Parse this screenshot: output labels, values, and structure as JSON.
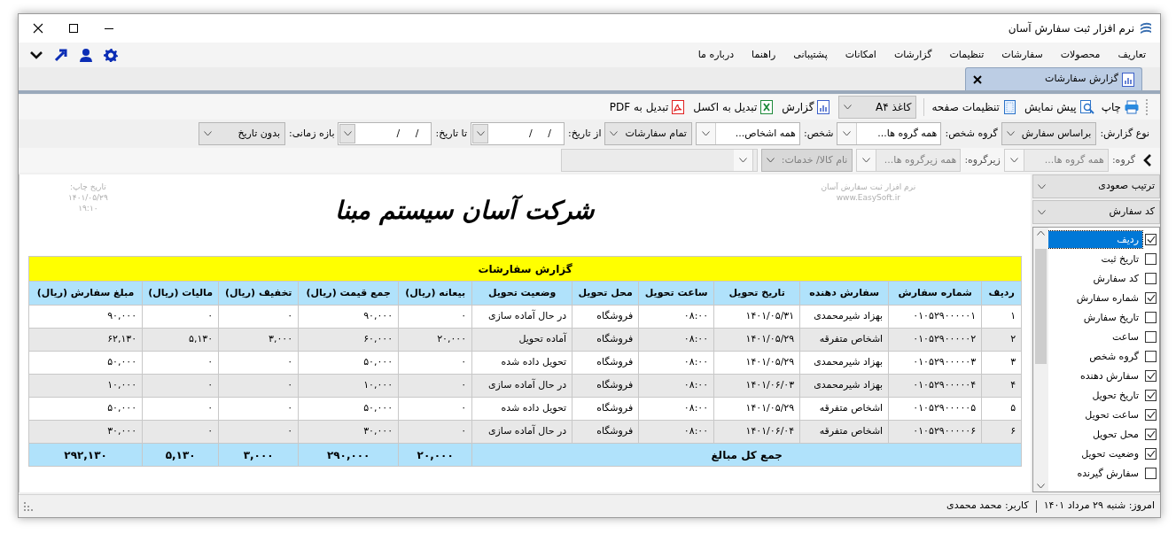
{
  "window": {
    "title": "نرم افزار ثبت سفارش آسان"
  },
  "menu": {
    "items": [
      "تعاریف",
      "محصولات",
      "سفارشات",
      "تنظیمات",
      "گزارشات",
      "امکانات",
      "پشتیبانی",
      "راهنما",
      "درباره ما"
    ]
  },
  "tabs": [
    {
      "label": "گزارش سفارشات",
      "selected": true
    }
  ],
  "toolbar": [
    {
      "kind": "print",
      "label": "چاپ"
    },
    {
      "kind": "preview",
      "label": "پیش نمایش"
    },
    {
      "kind": "page-setup",
      "label": "تنظیمات صفحه"
    },
    {
      "kind": "dropdown",
      "label": "کاغذ A۴"
    },
    {
      "kind": "report",
      "label": "گزارش"
    },
    {
      "kind": "excel",
      "label": "تبدیل به اکسل"
    },
    {
      "kind": "pdf",
      "label": "تبدیل به PDF"
    }
  ],
  "filters": [
    {
      "kind": "select",
      "label": "نوع گزارش:",
      "value": "براساس سفارش"
    },
    {
      "kind": "entry",
      "label": "گروه شخص:",
      "value": "همه گروه ها..."
    },
    {
      "kind": "entry",
      "label": "شخص:",
      "value": "همه اشخاص..."
    },
    {
      "kind": "select",
      "value": "تمام سفارشات"
    },
    {
      "kind": "date",
      "label": "از تاریخ:",
      "value": "/     /"
    },
    {
      "kind": "date",
      "label": "تا تاریخ:",
      "value": "/     /"
    },
    {
      "kind": "select",
      "label": "بازه زمانی:",
      "value": "بدون تاریخ"
    }
  ],
  "filters_2": [
    {
      "kind": "entry",
      "label": "گروه:",
      "value": "همه گروه ها...",
      "disabled": true
    },
    {
      "kind": "entry",
      "label": "زیرگروه:",
      "value": "همه زیرگروه ها...",
      "disabled": true
    },
    {
      "kind": "select",
      "value": "نام کالا/ خدمات:",
      "disabled": true
    },
    {
      "kind": "entry",
      "disabled": true
    }
  ],
  "report": {
    "print_date": [
      "تاریخ چاپ:",
      "۱۴۰۱/۰۵/۲۹",
      "۱۹:۱۰"
    ],
    "company": "شرکت آسان سیستم مبنا",
    "software": [
      "نرم افزار ثبت سفارش آسان",
      "www.EasySoft.ir"
    ],
    "table": {
      "title": "گزارش سفارشات",
      "columns": [
        "ردیف",
        "شماره سفارش",
        "سفارش دهنده",
        "تاریخ تحویل",
        "ساعت تحویل",
        "محل تحویل",
        "وضعیت تحویل",
        "بیعانه (ریال)",
        "جمع قیمت (ریال)",
        "تخفیف (ریال)",
        "مالیات (ریال)",
        "مبلغ سفارش (ریال)"
      ],
      "rows": [
        [
          "۱",
          "۰۱۰۵۲۹۰۰۰۰۰۱",
          "بهزاد شیرمحمدی",
          "۱۴۰۱/۰۵/۳۱",
          "۰۸:۰۰",
          "فروشگاه",
          "در حال آماده سازی",
          "۰",
          "۹۰,۰۰۰",
          "۰",
          "۰",
          "۹۰,۰۰۰"
        ],
        [
          "۲",
          "۰۱۰۵۲۹۰۰۰۰۰۲",
          "اشخاص متفرقه",
          "۱۴۰۱/۰۵/۲۹",
          "۰۸:۰۰",
          "فروشگاه",
          "آماده تحویل",
          "۲۰,۰۰۰",
          "۶۰,۰۰۰",
          "۳,۰۰۰",
          "۵,۱۳۰",
          "۶۲,۱۳۰"
        ],
        [
          "۳",
          "۰۱۰۵۲۹۰۰۰۰۰۳",
          "بهزاد شیرمحمدی",
          "۱۴۰۱/۰۵/۲۹",
          "۰۸:۰۰",
          "فروشگاه",
          "تحویل داده شده",
          "۰",
          "۵۰,۰۰۰",
          "۰",
          "۰",
          "۵۰,۰۰۰"
        ],
        [
          "۴",
          "۰۱۰۵۲۹۰۰۰۰۰۴",
          "بهزاد شیرمحمدی",
          "۱۴۰۱/۰۶/۰۳",
          "۰۸:۰۰",
          "فروشگاه",
          "در حال آماده سازی",
          "۰",
          "۱۰,۰۰۰",
          "۰",
          "۰",
          "۱۰,۰۰۰"
        ],
        [
          "۵",
          "۰۱۰۵۲۹۰۰۰۰۰۵",
          "اشخاص متفرقه",
          "۱۴۰۱/۰۵/۲۹",
          "۰۸:۰۰",
          "فروشگاه",
          "تحویل داده شده",
          "۰",
          "۵۰,۰۰۰",
          "۰",
          "۰",
          "۵۰,۰۰۰"
        ],
        [
          "۶",
          "۰۱۰۵۲۹۰۰۰۰۰۶",
          "اشخاص متفرقه",
          "۱۴۰۱/۰۶/۰۴",
          "۰۸:۰۰",
          "فروشگاه",
          "در حال آماده سازی",
          "۰",
          "۳۰,۰۰۰",
          "۰",
          "۰",
          "۳۰,۰۰۰"
        ]
      ],
      "totals": {
        "label": "جمع کل مبالغ",
        "values": [
          "۲۰,۰۰۰",
          "۲۹۰,۰۰۰",
          "۳,۰۰۰",
          "۵,۱۳۰",
          "۲۹۲,۱۳۰"
        ]
      }
    }
  },
  "side_panel": {
    "sort_order": "ترتیب صعودی",
    "sort_field": "کد سفارش",
    "items": [
      {
        "label": "ردیف",
        "checked": true,
        "selected": true
      },
      {
        "label": "تاریخ ثبت",
        "checked": false,
        "selected": false
      },
      {
        "label": "کد سفارش",
        "checked": false,
        "selected": false
      },
      {
        "label": "شماره سفارش",
        "checked": true,
        "selected": false
      },
      {
        "label": "تاریخ سفارش",
        "checked": false,
        "selected": false
      },
      {
        "label": "ساعت",
        "checked": false,
        "selected": false
      },
      {
        "label": "گروه شخص",
        "checked": false,
        "selected": false
      },
      {
        "label": "سفارش دهنده",
        "checked": true,
        "selected": false
      },
      {
        "label": "تاریخ تحویل",
        "checked": true,
        "selected": false
      },
      {
        "label": "ساعت تحویل",
        "checked": true,
        "selected": false
      },
      {
        "label": "محل تحویل",
        "checked": true,
        "selected": false
      },
      {
        "label": "وضعیت تحویل",
        "checked": true,
        "selected": false
      },
      {
        "label": "سفارش گیرنده",
        "checked": false,
        "selected": false
      }
    ]
  },
  "status_bar": {
    "date": "امروز: شنبه ۲۹ مرداد ۱۴۰۱",
    "user": "کاربر: محمد محمدی"
  }
}
